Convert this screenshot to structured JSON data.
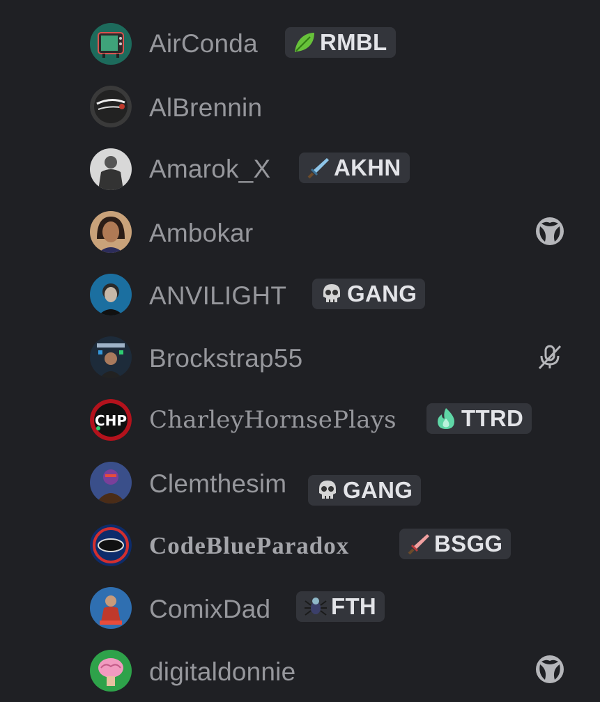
{
  "members": [
    {
      "name": "AirConda",
      "tag": "RMBL",
      "tag_icon": "leaf-icon",
      "avatar": "tv-avatar"
    },
    {
      "name": "AlBrennin",
      "avatar": "world-series-avatar"
    },
    {
      "name": "Amarok_X",
      "tag": "AKHN",
      "tag_icon": "sword-icon",
      "avatar": "person-avatar"
    },
    {
      "name": "Ambokar",
      "avatar": "person-avatar",
      "status_icon": "xbox-icon"
    },
    {
      "name": "ANVILIGHT",
      "tag": "GANG",
      "tag_icon": "skull-icon",
      "avatar": "person-avatar"
    },
    {
      "name": "Brockstrap55",
      "avatar": "person-avatar",
      "status_icon": "muted-mic-icon"
    },
    {
      "name": "CharleyHornsePlays",
      "tag": "TTRD",
      "tag_icon": "flame-icon",
      "avatar": "chp-logo-avatar",
      "avatar_text": "CHP"
    },
    {
      "name": "Clemthesim",
      "tag": "GANG",
      "tag_icon": "skull-icon",
      "avatar": "character-avatar"
    },
    {
      "name": "CodeBlueParadox",
      "tag": "BSGG",
      "tag_icon": "sword-icon",
      "avatar": "cb-logo-avatar"
    },
    {
      "name": "ComixDad",
      "tag": "FTH",
      "tag_icon": "spider-icon",
      "avatar": "comic-avatar"
    },
    {
      "name": "digitaldonnie",
      "avatar": "brain-avatar",
      "status_icon": "xbox-icon"
    }
  ],
  "colors": {
    "background": "#1f2024",
    "name": "#96979c",
    "tag_background": "#33353b",
    "tag_text": "#e3e4e8",
    "status_icon": "#b5b6ba"
  }
}
